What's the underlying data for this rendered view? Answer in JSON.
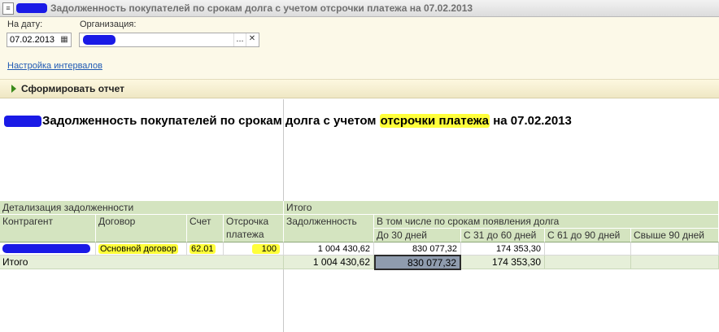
{
  "window": {
    "title": "Задолженность покупателей по срокам долга с учетом отсрочки платежа на 07.02.2013"
  },
  "form": {
    "date_label": "На дату:",
    "date_value": "07.02.2013",
    "org_label": "Организация:",
    "org_value": "",
    "select_label": "...",
    "clear_label": "✕",
    "intervals_link": "Настройка интервалов"
  },
  "command_bar": {
    "generate_label": "Сформировать отчет"
  },
  "report": {
    "title_before": "Задолженность покупателей по срокам долга с учетом ",
    "title_highlight": "отсрочки платежа",
    "title_after": " на 07.02.2013",
    "header": {
      "group_detail": "Детализация задолженности",
      "group_total": "Итого",
      "counterparty": "Контрагент",
      "contract": "Договор",
      "account": "Счет",
      "deferral": "Отсрочка платежа",
      "debt": "Задолженность",
      "by_terms": "В том числе по срокам появления долга",
      "period_1": "До 30 дней",
      "period_2": "С 31 до 60 дней",
      "period_3": "С 61 до 90 дней",
      "period_4": "Свыше 90 дней"
    },
    "rows": [
      {
        "counterparty": "",
        "contract": "Основной договор",
        "account": "62.01",
        "deferral": "100",
        "debt": "1 004 430,62",
        "period_1": "830 077,32",
        "period_2": "174 353,30",
        "period_3": "",
        "period_4": ""
      }
    ],
    "total": {
      "label": "Итого",
      "debt": "1 004 430,62",
      "period_1": "830 077,32",
      "period_2": "174 353,30",
      "period_3": "",
      "period_4": ""
    }
  },
  "colors": {
    "header_bg": "#d4e4c0",
    "highlight": "#ffff3a",
    "redaction": "#1a1ae6",
    "form_bg": "#fcf9e8"
  },
  "icons": {
    "window": "report-icon",
    "calendar": "calendar-icon",
    "generate": "play-icon"
  }
}
